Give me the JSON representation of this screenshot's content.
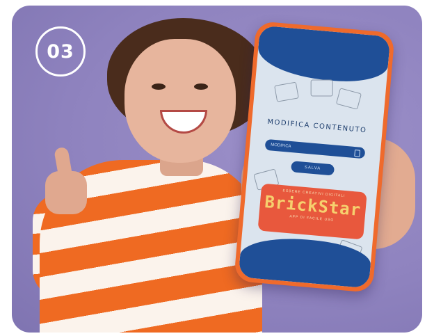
{
  "step": {
    "number": "03"
  },
  "phone": {
    "screen_title": "MODIFICA CONTENUTO",
    "input_placeholder": "MODIFICA",
    "button_label": "SALVA",
    "promo": {
      "top_text": "ESSERE CREATIVI DIGITALI",
      "brand": "BrickStar",
      "bottom_text": "APP DI FACILE USO"
    }
  },
  "colors": {
    "background": "#8f83bf",
    "phone_frame": "#ef6a2c",
    "screen_accent": "#1f4f97",
    "promo_bg": "#e8583d"
  }
}
